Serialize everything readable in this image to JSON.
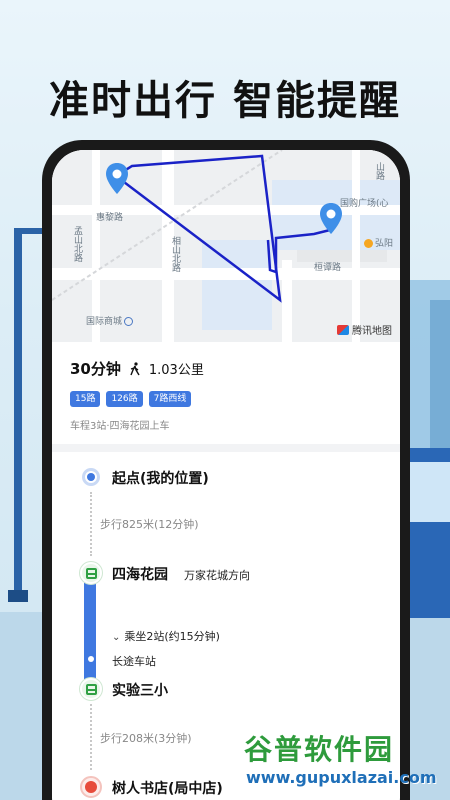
{
  "headline": "准时出行 智能提醒",
  "map": {
    "labels": {
      "huili_road": "惠黎路",
      "mengshan_north_road": "孟山北路",
      "xiangshan_north_road": "相山北路",
      "hengtan_road": "桓谭路",
      "intl_mall": "国际商城",
      "intl_plaza": "国购广场(心",
      "hongyang": "弘阳",
      "mountain_road": "山路"
    },
    "provider": "腾讯地图"
  },
  "summary": {
    "duration": "30分钟",
    "walk_distance": "1.03公里",
    "lines": [
      "15路",
      "126路",
      "7路西线"
    ],
    "note": "车程3站·四海花园上车"
  },
  "steps": {
    "start_label": "起点(我的位置)",
    "walk1": "步行825米(12分钟)",
    "board_stop": "四海花园",
    "board_direction": "万家花城方向",
    "ride_info": "乘坐2站(约15分钟)",
    "mid_stop": "长途车站",
    "alight_stop": "实验三小",
    "walk2": "步行208米(3分钟)",
    "end_label": "树人书店(局中店)"
  },
  "watermark": {
    "title": "谷普软件园",
    "url": "www.gupuxlazai.com"
  },
  "colors": {
    "accent": "#3f78e0",
    "bus_green": "#2fa043",
    "end_red": "#e74c3c",
    "route_line": "#1a22c7"
  }
}
